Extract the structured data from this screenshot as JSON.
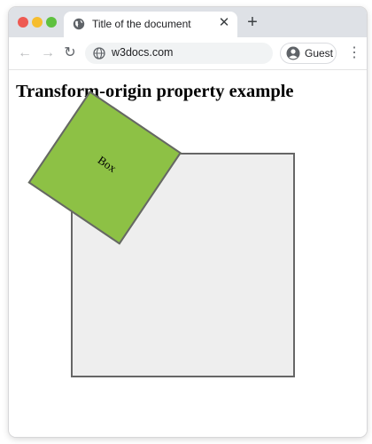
{
  "browser": {
    "tab": {
      "title": "Title of the document",
      "favicon": "globe-icon",
      "close_glyph": "✕"
    },
    "new_tab_glyph": "+",
    "address_bar": {
      "url": "w3docs.com",
      "icon": "globe-icon"
    },
    "profile": {
      "label": "Guest",
      "icon": "avatar-icon"
    },
    "nav_icons": [
      "back-arrow-icon",
      "forward-arrow-icon",
      "reload-icon",
      "more-vertical-icon"
    ]
  },
  "page": {
    "heading": "Transform-origin property example",
    "box_label": "Box"
  },
  "colors": {
    "tabstrip": "#dee1e6",
    "container_bg": "#eeeeee",
    "box_fill": "#8dc145",
    "border": "#666666",
    "traffic_red": "#ee5a52",
    "traffic_yellow": "#f6bd2e",
    "traffic_green": "#5fc13f"
  }
}
